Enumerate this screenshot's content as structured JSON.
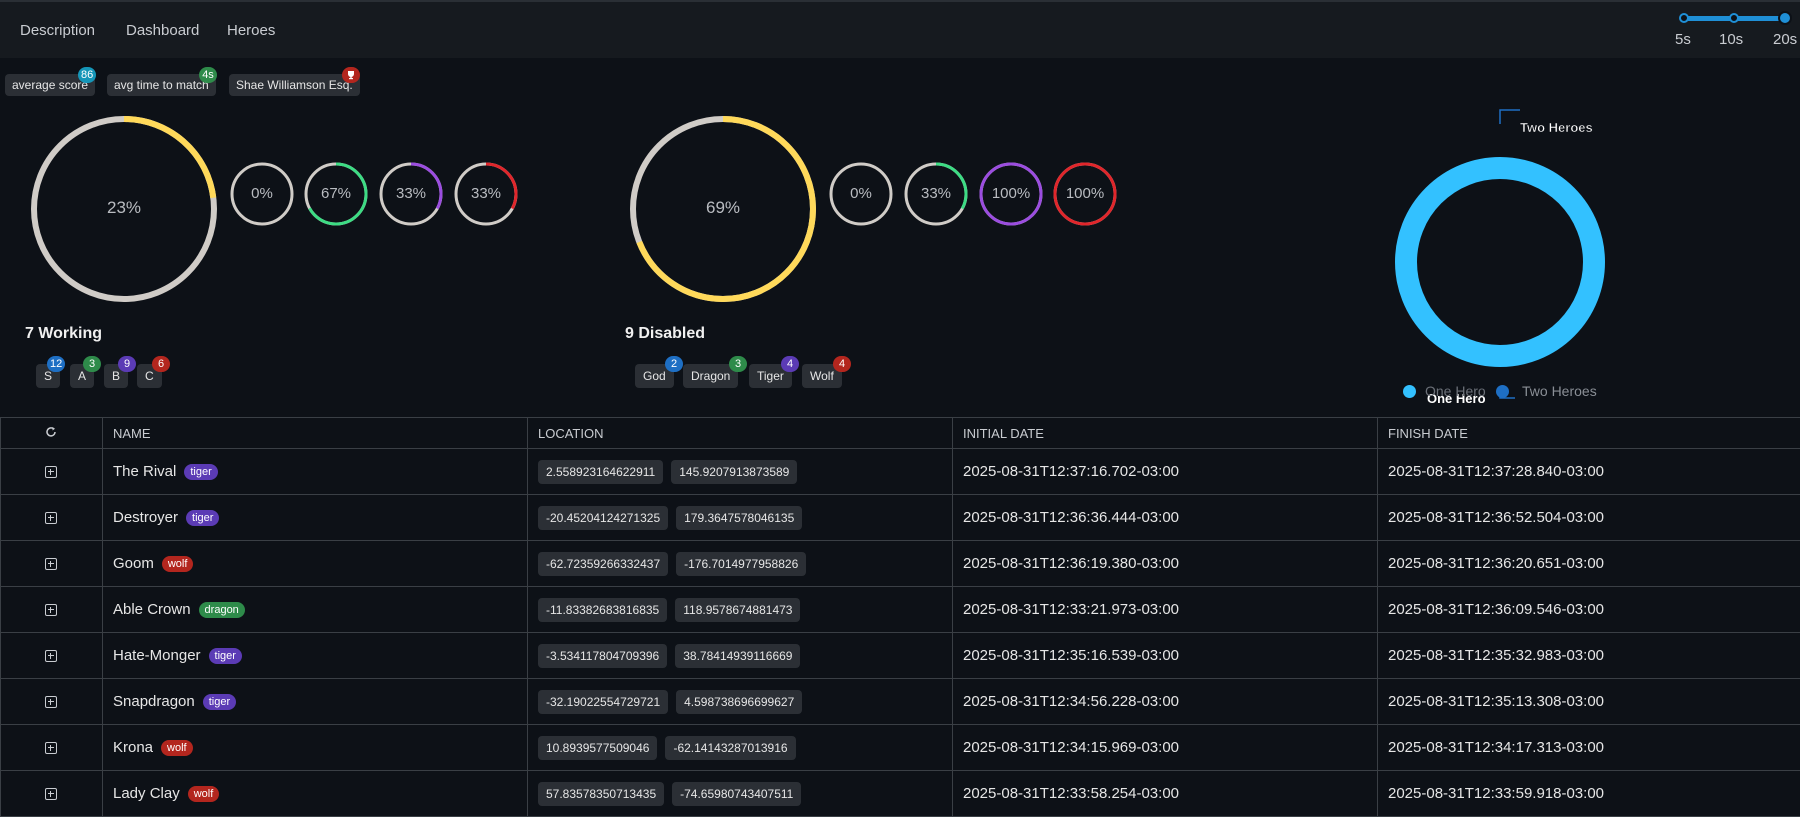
{
  "nav": {
    "items": [
      "Description",
      "Dashboard",
      "Heroes"
    ]
  },
  "interval": {
    "ticks": [
      "5s",
      "10s",
      "20s"
    ],
    "selected": "20s"
  },
  "stat_chips": {
    "avg_score": {
      "label": "average score",
      "badge": "86"
    },
    "avg_time": {
      "label": "avg time to match",
      "badge": "4s"
    },
    "top_player": {
      "label": "Shae Williamson Esq.",
      "badge_icon": "trophy-icon"
    }
  },
  "working": {
    "title": "7 Working",
    "main_ring": {
      "label": "23%",
      "value": 0.23,
      "color": "#ffd95a"
    },
    "small_rings": [
      {
        "label": "0%",
        "value": 0.0,
        "color": "#3ddc84"
      },
      {
        "label": "67%",
        "value": 0.67,
        "color": "#3ddc84"
      },
      {
        "label": "33%",
        "value": 0.33,
        "color": "#9b4de0"
      },
      {
        "label": "33%",
        "value": 0.33,
        "color": "#e0262b"
      }
    ],
    "grades": [
      {
        "label": "S",
        "count": "12",
        "color": "#1e6fc4"
      },
      {
        "label": "A",
        "count": "3",
        "color": "#2e8b4a"
      },
      {
        "label": "B",
        "count": "9",
        "color": "#5b3bb5"
      },
      {
        "label": "C",
        "count": "6",
        "color": "#b3261e"
      }
    ]
  },
  "disabled": {
    "title": "9 Disabled",
    "main_ring": {
      "label": "69%",
      "value": 0.69,
      "color": "#ffd95a"
    },
    "small_rings": [
      {
        "label": "0%",
        "value": 0.0,
        "color": "#3ddc84"
      },
      {
        "label": "33%",
        "value": 0.33,
        "color": "#3ddc84"
      },
      {
        "label": "100%",
        "value": 1.0,
        "color": "#9b4de0"
      },
      {
        "label": "100%",
        "value": 1.0,
        "color": "#e0262b"
      }
    ],
    "classes": [
      {
        "label": "God",
        "count": "2",
        "color": "#1e6fc4"
      },
      {
        "label": "Dragon",
        "count": "3",
        "color": "#2e8b4a"
      },
      {
        "label": "Tiger",
        "count": "4",
        "color": "#5b3bb5"
      },
      {
        "label": "Wolf",
        "count": "4",
        "color": "#b3261e"
      }
    ]
  },
  "chart_data": {
    "type": "pie",
    "categories": [
      "One Hero",
      "Two Heroes"
    ],
    "values": [
      100,
      0
    ],
    "colors": [
      "#33c1ff",
      "#1e6fc4"
    ],
    "annotations": [
      "Two Heroes",
      "One Hero"
    ],
    "legend": "bottom"
  },
  "table": {
    "columns": [
      "NAME",
      "LOCATION",
      "INITIAL DATE",
      "FINISH DATE"
    ],
    "rows": [
      {
        "name": "The Rival",
        "tag": "tiger",
        "lat": "2.558923164622911",
        "lng": "145.9207913873589",
        "start": "2025-08-31T12:37:16.702-03:00",
        "end": "2025-08-31T12:37:28.840-03:00"
      },
      {
        "name": "Destroyer",
        "tag": "tiger",
        "lat": "-20.45204124271325",
        "lng": "179.3647578046135",
        "start": "2025-08-31T12:36:36.444-03:00",
        "end": "2025-08-31T12:36:52.504-03:00"
      },
      {
        "name": "Goom",
        "tag": "wolf",
        "lat": "-62.72359266332437",
        "lng": "-176.7014977958826",
        "start": "2025-08-31T12:36:19.380-03:00",
        "end": "2025-08-31T12:36:20.651-03:00"
      },
      {
        "name": "Able Crown",
        "tag": "dragon",
        "lat": "-11.83382683816835",
        "lng": "118.9578674881473",
        "start": "2025-08-31T12:33:21.973-03:00",
        "end": "2025-08-31T12:36:09.546-03:00"
      },
      {
        "name": "Hate-Monger",
        "tag": "tiger",
        "lat": "-3.534117804709396",
        "lng": "38.78414939116669",
        "start": "2025-08-31T12:35:16.539-03:00",
        "end": "2025-08-31T12:35:32.983-03:00"
      },
      {
        "name": "Snapdragon",
        "tag": "tiger",
        "lat": "-32.19022554729721",
        "lng": "4.598738696699627",
        "start": "2025-08-31T12:34:56.228-03:00",
        "end": "2025-08-31T12:35:13.308-03:00"
      },
      {
        "name": "Krona",
        "tag": "wolf",
        "lat": "10.8939577509046",
        "lng": "-62.14143287013916",
        "start": "2025-08-31T12:34:15.969-03:00",
        "end": "2025-08-31T12:34:17.313-03:00"
      },
      {
        "name": "Lady Clay",
        "tag": "wolf",
        "lat": "57.83578350713435",
        "lng": "-74.65980743407511",
        "start": "2025-08-31T12:33:58.254-03:00",
        "end": "2025-08-31T12:33:59.918-03:00"
      }
    ]
  }
}
